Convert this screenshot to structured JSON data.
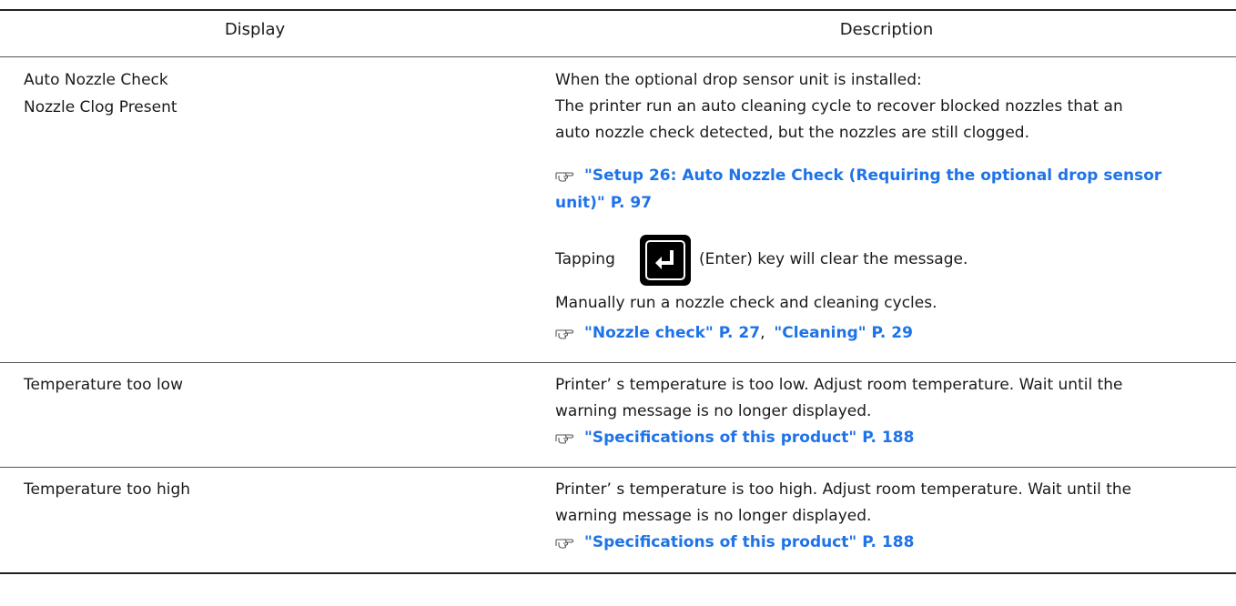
{
  "headers": {
    "display": "Display",
    "description": "Description"
  },
  "rows": [
    {
      "display": [
        "Auto Nozzle Check",
        "Nozzle Clog Present"
      ],
      "description": {
        "line1": "When the optional drop sensor unit is installed:",
        "line2": "The printer run an auto cleaning cycle to recover blocked nozzles that an",
        "line3": "auto nozzle check detected, but the nozzles are still clogged.",
        "ref1_line1": "\"Setup 26: Auto Nozzle Check (Requiring the optional drop sensor",
        "ref1_line2": "unit)\" P. 97",
        "tap_before": "Tapping",
        "tap_after": "(Enter) key will clear the message.",
        "manual": "Manually run a nozzle check and cleaning cycles.",
        "ref2a": "\"Nozzle check\" P. 27",
        "ref2_sep": ",",
        "ref2b": "\"Cleaning\" P. 29"
      }
    },
    {
      "display": [
        "Temperature too low"
      ],
      "description": {
        "line1": "Printer’ s temperature is too low. Adjust room temperature. Wait until the",
        "line2": "warning message is no longer displayed.",
        "ref": "\"Specifications of this product\" P. 188"
      }
    },
    {
      "display": [
        "Temperature too high"
      ],
      "description": {
        "line1": "Printer’ s temperature is too high. Adjust room temperature. Wait until the",
        "line2": "warning message is no longer displayed.",
        "ref": "\"Specifications of this product\" P. 188"
      }
    }
  ],
  "icons": {
    "reference": "pointing-hand-icon",
    "enter_key": "enter-key-icon"
  },
  "colors": {
    "link": "#1e73e8",
    "rule": "#222222"
  }
}
